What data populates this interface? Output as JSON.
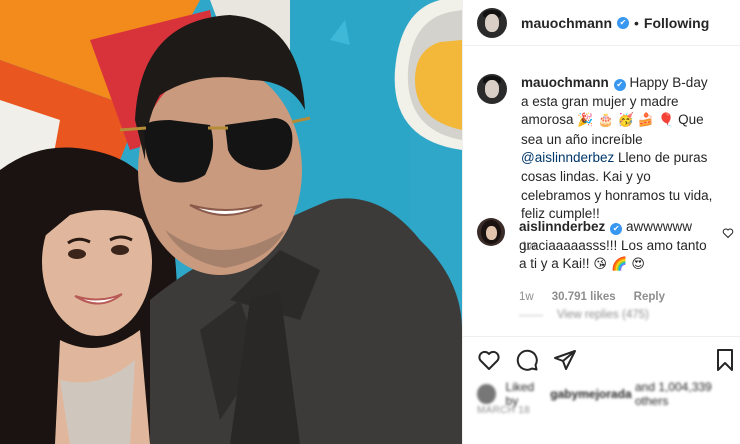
{
  "post": {
    "author": "mauochmann",
    "follow_status": "Following",
    "separator": "•"
  },
  "caption": {
    "username": "mauochmann",
    "line1": "Happy B-day a esta gran mujer y madre amorosa",
    "emojis1": "🎉 🎂",
    "emojis2": "🥳 🍰 🎈",
    "line2": "Que sea un año increíble",
    "mention": "@aislinnderbez",
    "line3": "Lleno de puras cosas lindas. Kai y yo celebramos y honramos tu vida, feliz cumple!!",
    "time": "1w"
  },
  "reply_comment": {
    "username": "aislinnderbez",
    "text": "awwwwww graciaaaaasss!!! Los amo tanto a ti y a Kai!!",
    "emojis": "😘 🌈 😍",
    "time": "1w",
    "likes": "30.791 likes",
    "reply_label": "Reply"
  },
  "view_replies": "View replies (475)",
  "liked_by": {
    "prefix": "Liked by",
    "user": "gabymejorada",
    "suffix": "and 1,004,339 others"
  },
  "date": "MARCH 18",
  "colors": {
    "verified": "#3897f0",
    "mention": "#00376b",
    "muted": "#8e8e8e"
  },
  "icons": {
    "like": "heart-icon",
    "comment": "comment-icon",
    "share": "share-icon",
    "save": "bookmark-icon",
    "verified": "verified-badge-icon"
  }
}
